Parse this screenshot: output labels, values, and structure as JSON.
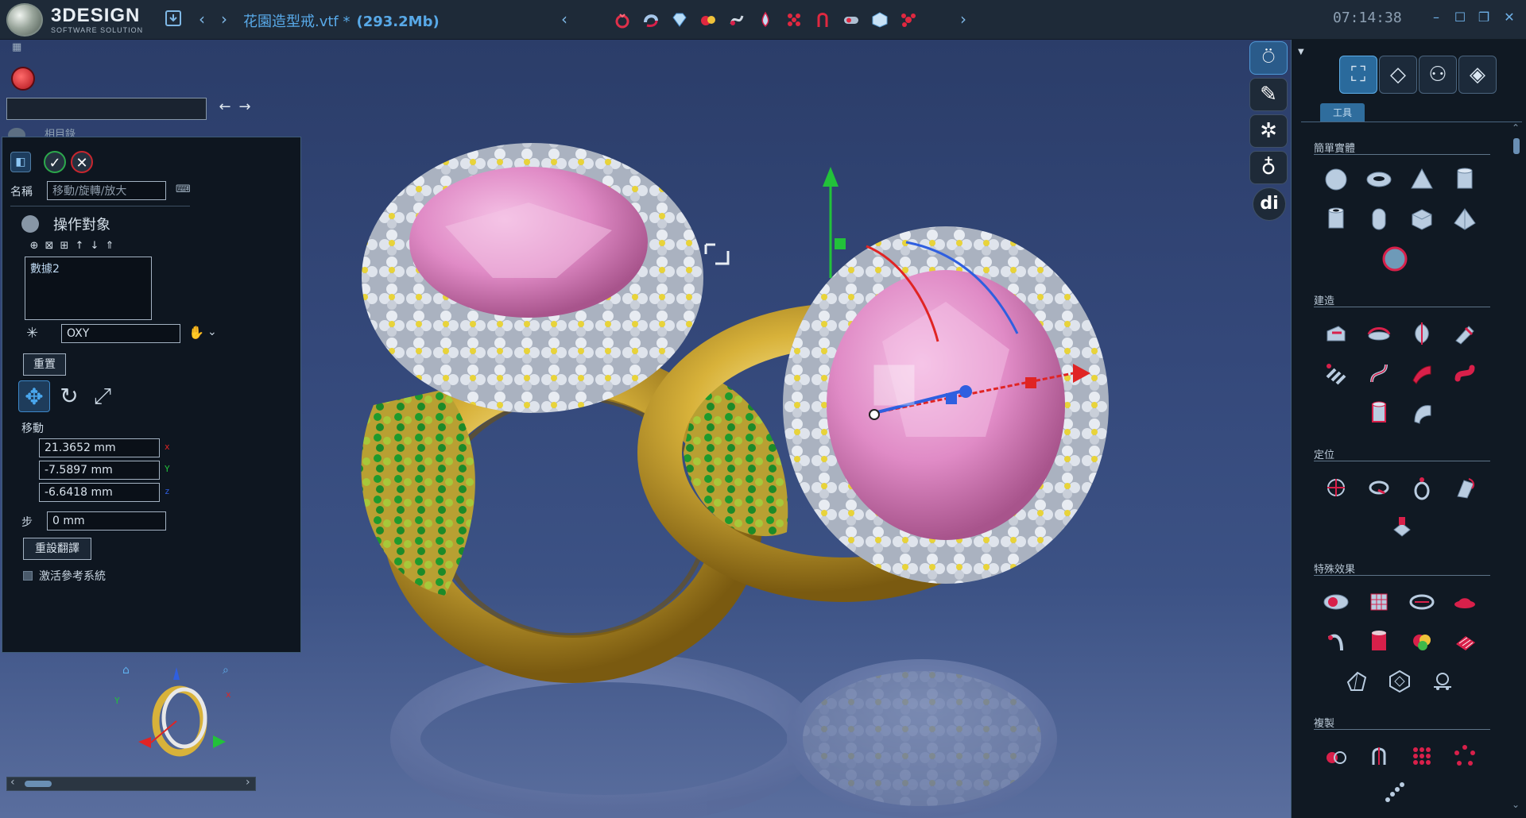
{
  "app": {
    "brand_name": "3DESIGN",
    "brand_sub": "SOFTWARE SOLUTION",
    "document_title": "花園造型戒.vtf *",
    "document_size": "(293.2Mb)",
    "clock": "07:14:38"
  },
  "command": {
    "input_value": "",
    "peek_text": "相目錄"
  },
  "properties": {
    "name_label": "名稱",
    "name_value": "移動/旋轉/放大",
    "objects_title": "操作對象",
    "objects": [
      "數據2"
    ],
    "plane_value": "OXY",
    "reset_label": "重置",
    "move_label": "移動",
    "move_x": "21.3652 mm",
    "move_y": "-7.5897 mm",
    "move_z": "-6.6418 mm",
    "axis_x": "x",
    "axis_y": "Y",
    "axis_z": "z",
    "step_label": "步",
    "step_value": "0 mm",
    "reset_translate_label": "重設翻譯",
    "activate_ref_label": "激活參考系統"
  },
  "tools_panel": {
    "subtab": "工具",
    "sections": {
      "simple_solids": "簡單實體",
      "build": "建造",
      "position": "定位",
      "special_effects": "特殊效果",
      "copy": "複製"
    }
  },
  "colors": {
    "accent": "#58a9e8",
    "ok_green": "#2ca84c",
    "cancel_red": "#c8262e",
    "axis_x": "#e02424",
    "axis_y": "#22c23a",
    "axis_z": "#2f5fe0",
    "gold": "#d8b23a",
    "gem_pink": "#e58fc9"
  },
  "icons": {
    "toolbar": [
      "save-icon",
      "back-icon",
      "forward-icon",
      "ring-icon",
      "bangle-icon",
      "gem-icon",
      "stones-icon",
      "curve-icon",
      "drop-icon",
      "pave-icon",
      "prong-icon",
      "pipe-icon",
      "cube-icon",
      "cluster-icon"
    ],
    "side_strip": [
      "ring-tool-icon",
      "sketch-icon",
      "wireframe-icon",
      "gem-setting-icon",
      "di-icon"
    ]
  }
}
